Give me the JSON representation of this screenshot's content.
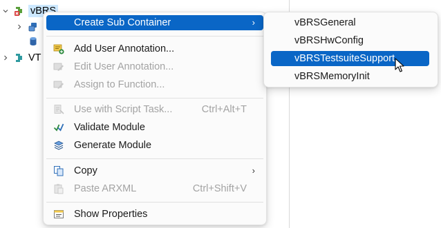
{
  "tree": {
    "root_label": "vBRS",
    "second_label": "VT"
  },
  "context_menu": {
    "items": [
      {
        "label": "Create Sub Container",
        "shortcut": "",
        "has_submenu": true,
        "enabled": true,
        "highlighted": true
      },
      {
        "label": "Add User Annotation...",
        "shortcut": "",
        "has_submenu": false,
        "enabled": true
      },
      {
        "label": "Edit User Annotation...",
        "shortcut": "",
        "has_submenu": false,
        "enabled": false
      },
      {
        "label": "Assign to Function...",
        "shortcut": "",
        "has_submenu": false,
        "enabled": false
      },
      {
        "label": "Use with Script Task...",
        "shortcut": "Ctrl+Alt+T",
        "has_submenu": false,
        "enabled": false
      },
      {
        "label": "Validate Module",
        "shortcut": "",
        "has_submenu": false,
        "enabled": true
      },
      {
        "label": "Generate Module",
        "shortcut": "",
        "has_submenu": false,
        "enabled": true
      },
      {
        "label": "Copy",
        "shortcut": "",
        "has_submenu": true,
        "enabled": true
      },
      {
        "label": "Paste ARXML",
        "shortcut": "Ctrl+Shift+V",
        "has_submenu": false,
        "enabled": false
      },
      {
        "label": "Show Properties",
        "shortcut": "",
        "has_submenu": false,
        "enabled": true
      }
    ]
  },
  "submenu": {
    "items": [
      {
        "label": "vBRSGeneral",
        "highlighted": false
      },
      {
        "label": "vBRSHwConfig",
        "highlighted": false
      },
      {
        "label": "vBRSTestsuiteSupport",
        "highlighted": true
      },
      {
        "label": "vBRSMemoryInit",
        "highlighted": false
      }
    ]
  },
  "colors": {
    "highlight": "#0a66c6",
    "selection": "#cce8ff",
    "disabled_text": "#a3a3a3"
  }
}
